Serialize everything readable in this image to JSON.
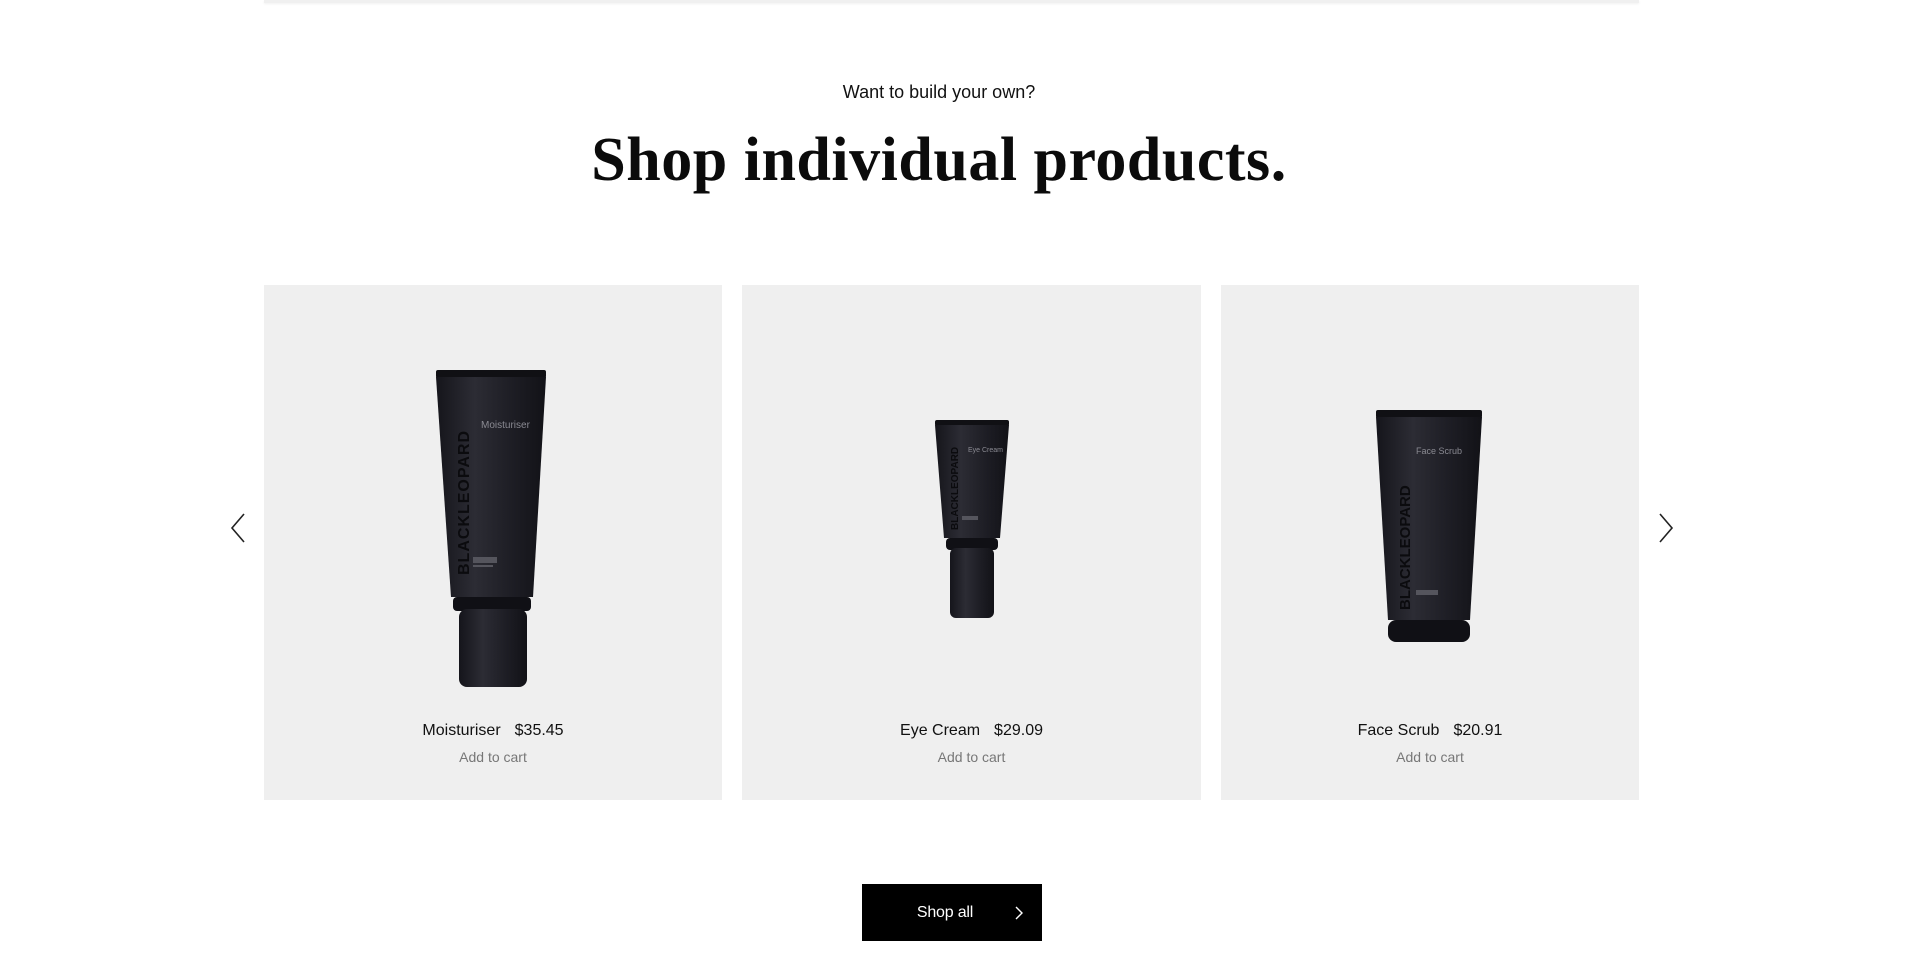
{
  "section": {
    "eyebrow": "Want to build your own?",
    "headline": "Shop individual products."
  },
  "carousel": {
    "prev_icon": "chevron-left-icon",
    "next_icon": "chevron-right-icon",
    "products": [
      {
        "name": "Moisturiser",
        "price": "$35.45",
        "cta": "Add to cart",
        "image_brand": "BLACKLEOPARD",
        "image_label": "Moisturiser"
      },
      {
        "name": "Eye Cream",
        "price": "$29.09",
        "cta": "Add to cart",
        "image_brand": "BLACKLEOPARD",
        "image_label": "Eye Cream"
      },
      {
        "name": "Face Scrub",
        "price": "$20.91",
        "cta": "Add to cart",
        "image_brand": "BLACKLEOPARD",
        "image_label": "Face Scrub"
      }
    ]
  },
  "shop_all": {
    "label": "Shop all",
    "icon": "chevron-right-icon"
  },
  "colors": {
    "card_background": "#efefef",
    "button_background": "#000000",
    "tube": "#1f1f26"
  }
}
